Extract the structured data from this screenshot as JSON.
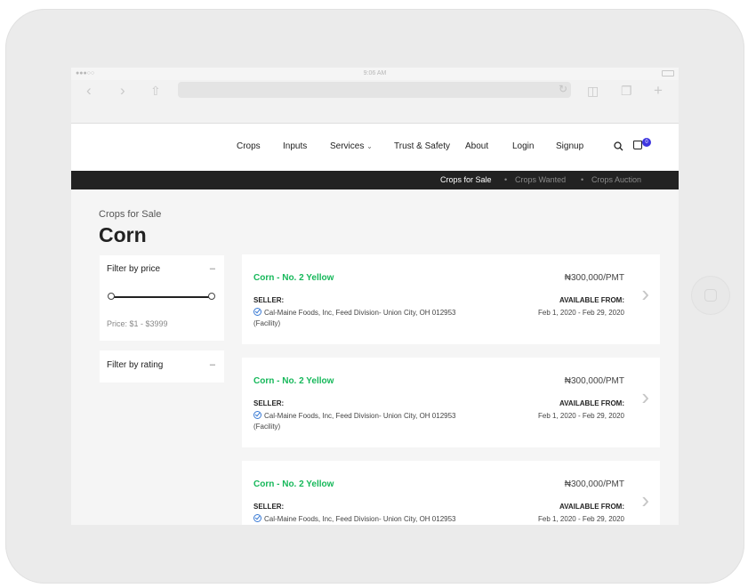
{
  "device": {
    "status_time": "9:06 AM"
  },
  "nav": {
    "items": [
      {
        "label": "Crops"
      },
      {
        "label": "Inputs"
      },
      {
        "label": "Services"
      },
      {
        "label": "Trust & Safety"
      },
      {
        "label": "About"
      },
      {
        "label": "Login"
      },
      {
        "label": "Signup"
      }
    ],
    "cart_count": "0"
  },
  "subnav": {
    "items": [
      {
        "label": "Crops for Sale",
        "active": true
      },
      {
        "label": "Crops Wanted",
        "active": false
      },
      {
        "label": "Crops Auction",
        "active": false
      }
    ],
    "separator": "•"
  },
  "page": {
    "breadcrumb": "Crops for Sale",
    "title": "Corn"
  },
  "filters": {
    "price": {
      "title": "Filter by price",
      "collapse_symbol": "–",
      "label": "Price: $1 - $3999",
      "range_min_fraction": 0.0,
      "range_max_fraction": 1.0
    },
    "rating": {
      "title": "Filter by rating",
      "collapse_symbol": "–"
    }
  },
  "listings": [
    {
      "name": "Corn - No. 2 Yellow",
      "price": "₦300,000/PMT",
      "seller_label": "SELLER:",
      "seller": "Cal-Maine Foods, Inc, Feed Division- Union City, OH 012953 (Facility)",
      "available_label": "AVAILABLE FROM:",
      "available": "Feb 1, 2020 - Feb 29, 2020"
    },
    {
      "name": "Corn - No. 2 Yellow",
      "price": "₦300,000/PMT",
      "seller_label": "SELLER:",
      "seller": "Cal-Maine Foods, Inc, Feed Division- Union City, OH 012953 (Facility)",
      "available_label": "AVAILABLE FROM:",
      "available": "Feb 1, 2020 - Feb 29, 2020"
    },
    {
      "name": "Corn - No. 2 Yellow",
      "price": "₦300,000/PMT",
      "seller_label": "SELLER:",
      "seller": "Cal-Maine Foods, Inc, Feed Division- Union City, OH 012953",
      "available_label": "AVAILABLE FROM:",
      "available": "Feb 1, 2020 - Feb 29, 2020"
    }
  ],
  "icons": {
    "search": "search-icon",
    "cart": "cart-icon",
    "chevron": "chevron-right-icon",
    "verified": "verified-check-icon"
  },
  "colors": {
    "accent_green": "#16b85a",
    "badge": "#3e36e0",
    "subnav_bg": "#222222"
  }
}
